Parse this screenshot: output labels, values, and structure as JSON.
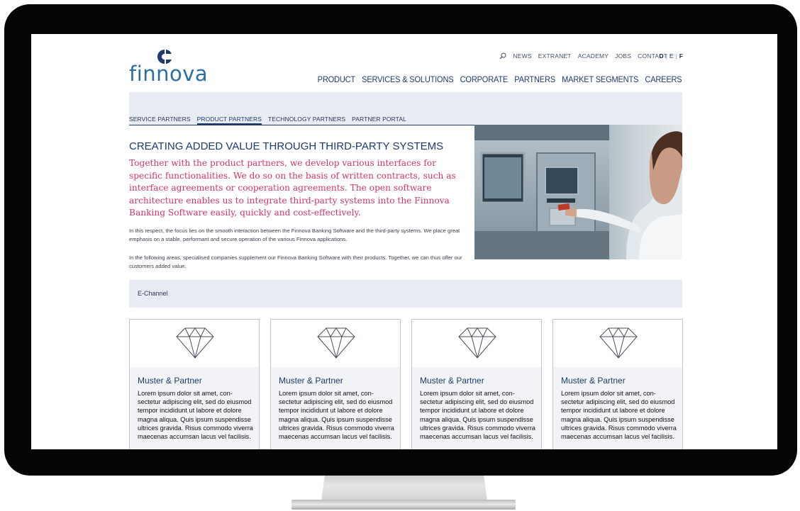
{
  "brand": {
    "logo_text": "finnova"
  },
  "utility_nav": [
    "NEWS",
    "EXTRANET",
    "ACADEMY",
    "JOBS",
    "CONTACT"
  ],
  "languages": [
    "D",
    "E",
    "F"
  ],
  "main_nav": [
    "PRODUCT",
    "SERVICES & SOLUTIONS",
    "CORPORATE",
    "PARTNERS",
    "MARKET SEGMENTS",
    "CAREERS"
  ],
  "sub_nav": {
    "items": [
      "SERVICE PARTNERS",
      "PRODUCT PARTNERS",
      "TECHNOLOGY PARTNERS",
      "PARTNER PORTAL"
    ],
    "active": "PRODUCT PARTNERS"
  },
  "content": {
    "heading": "CREATING ADDED VALUE THROUGH THIRD-PARTY SYSTEMS",
    "lead": "Together with the product partners, we develop various interfaces for specific functionalities. We do so on the basis of written contracts, such as interface agreements or cooperation agreements. The open software architecture enables us to integrate third-party systems into the Finnova Banking Software easily, quickly and cost-effectively.",
    "body_1": "In this respect, the focus lies on the smooth interaction between the Finnova Banking Software and the third-party systems. We place great emphasis on a stable, performant and secure operation of the various Finnova applications.",
    "body_2": "In the following areas, specialised companies supplement our Finnova Banking Software with their products. Together, we can thus offer our customers added value."
  },
  "section": {
    "title": "E-Channel"
  },
  "cards": [
    {
      "title": "Muster & Partner",
      "text": "Lorem ipsum dolor sit amet, con-sectetur adipiscing elit, sed do eiusmod tempor incididunt ut labore et dolore magna aliqua. Quis ipsum suspendisse ultrices gravida. Risus commodo viverra maecenas accumsan lacus vel facilisis."
    },
    {
      "title": "Muster & Partner",
      "text": "Lorem ipsum dolor sit amet, con-sectetur adipiscing elit, sed do eiusmod tempor incididunt ut labore et dolore magna aliqua. Quis ipsum suspendisse ultrices gravida. Risus commodo viverra maecenas accumsan lacus vel facilisis."
    },
    {
      "title": "Muster & Partner",
      "text": "Lorem ipsum dolor sit amet, con-sectetur adipiscing elit, sed do eiusmod tempor incididunt ut labore et dolore magna aliqua. Quis ipsum suspendisse ultrices gravida. Risus commodo viverra maecenas accumsan lacus vel facilisis."
    },
    {
      "title": "Muster & Partner",
      "text": "Lorem ipsum dolor sit amet, con-sectetur adipiscing elit, sed do eiusmod tempor incididunt ut labore et dolore magna aliqua. Quis ipsum suspendisse ultrices gravida. Risus commodo viverra maecenas accumsan lacus vel facilisis."
    }
  ],
  "colors": {
    "brand_blue": "#1e3a6e",
    "logo_blue": "#2d6ea1",
    "accent_pink": "#d6336a",
    "band_bg": "#e9ecf4",
    "bezel": "#050505"
  },
  "icons": [
    "search-icon",
    "diamond-icon",
    "finnova-logo-mark"
  ]
}
